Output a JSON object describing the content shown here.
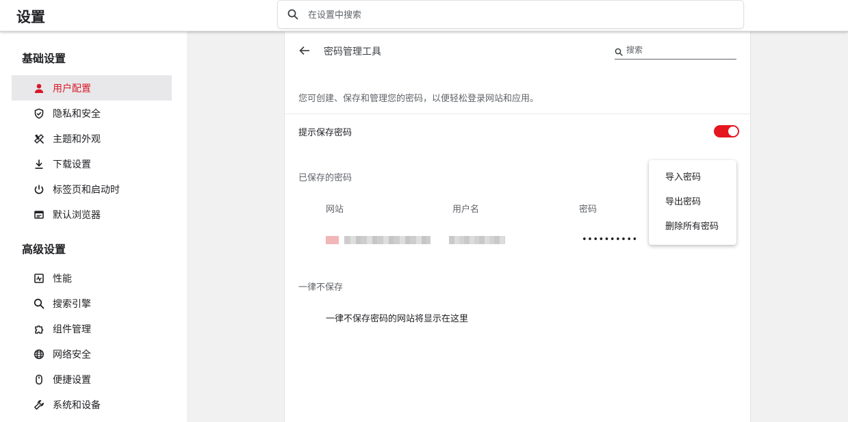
{
  "app": {
    "title": "设置"
  },
  "search": {
    "placeholder": "在设置中搜索"
  },
  "sidebar": {
    "basic_title": "基础设置",
    "basic_items": [
      {
        "label": "用户配置",
        "icon": "person-icon",
        "active": true
      },
      {
        "label": "隐私和安全",
        "icon": "shield-icon"
      },
      {
        "label": "主题和外观",
        "icon": "theme-brush-icon"
      },
      {
        "label": "下载设置",
        "icon": "download-icon"
      },
      {
        "label": "标签页和启动时",
        "icon": "power-icon"
      },
      {
        "label": "默认浏览器",
        "icon": "browser-window-icon"
      }
    ],
    "advanced_title": "高级设置",
    "advanced_items": [
      {
        "label": "性能",
        "icon": "performance-icon"
      },
      {
        "label": "搜索引擎",
        "icon": "search-icon"
      },
      {
        "label": "组件管理",
        "icon": "puzzle-icon"
      },
      {
        "label": "网络安全",
        "icon": "globe-icon"
      },
      {
        "label": "便捷设置",
        "icon": "mouse-icon"
      },
      {
        "label": "系统和设备",
        "icon": "wrench-icon"
      }
    ]
  },
  "panel": {
    "title": "密码管理工具",
    "search_placeholder": "搜索",
    "description": "您可创建、保存和管理您的密码，以便轻松登录网站和应用。",
    "offer_to_save_label": "提示保存密码",
    "offer_to_save_enabled": true,
    "saved_passwords_title": "已保存的密码",
    "columns": {
      "site": "网站",
      "username": "用户名",
      "password": "密码"
    },
    "rows": [
      {
        "password_mask": "••••••••••"
      }
    ],
    "never_saved_title": "一律不保存",
    "never_saved_empty": "一律不保存密码的网站将显示在这里"
  },
  "menu": {
    "items": [
      "导入密码",
      "导出密码",
      "删除所有密码"
    ]
  },
  "colors": {
    "accent": "#d7182a",
    "toggle_on": "#e5161f",
    "active_bg": "#e8e8ea"
  }
}
